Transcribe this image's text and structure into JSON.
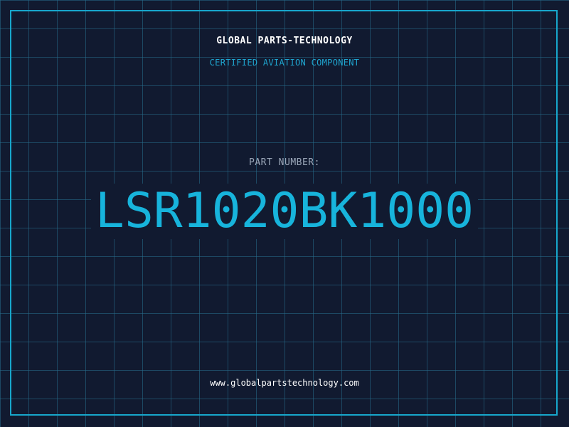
{
  "header": {
    "company": "GLOBAL PARTS-TECHNOLOGY",
    "subtitle": "CERTIFIED AVIATION COMPONENT"
  },
  "part": {
    "label": "PART NUMBER:",
    "number": "LSR1020BK1000"
  },
  "footer": {
    "website": "www.globalpartstechnology.com"
  },
  "colors": {
    "background": "#111a30",
    "grid": "#266e8c",
    "accent": "#17b4dc",
    "label": "#9aa6b8",
    "text": "#ffffff"
  }
}
